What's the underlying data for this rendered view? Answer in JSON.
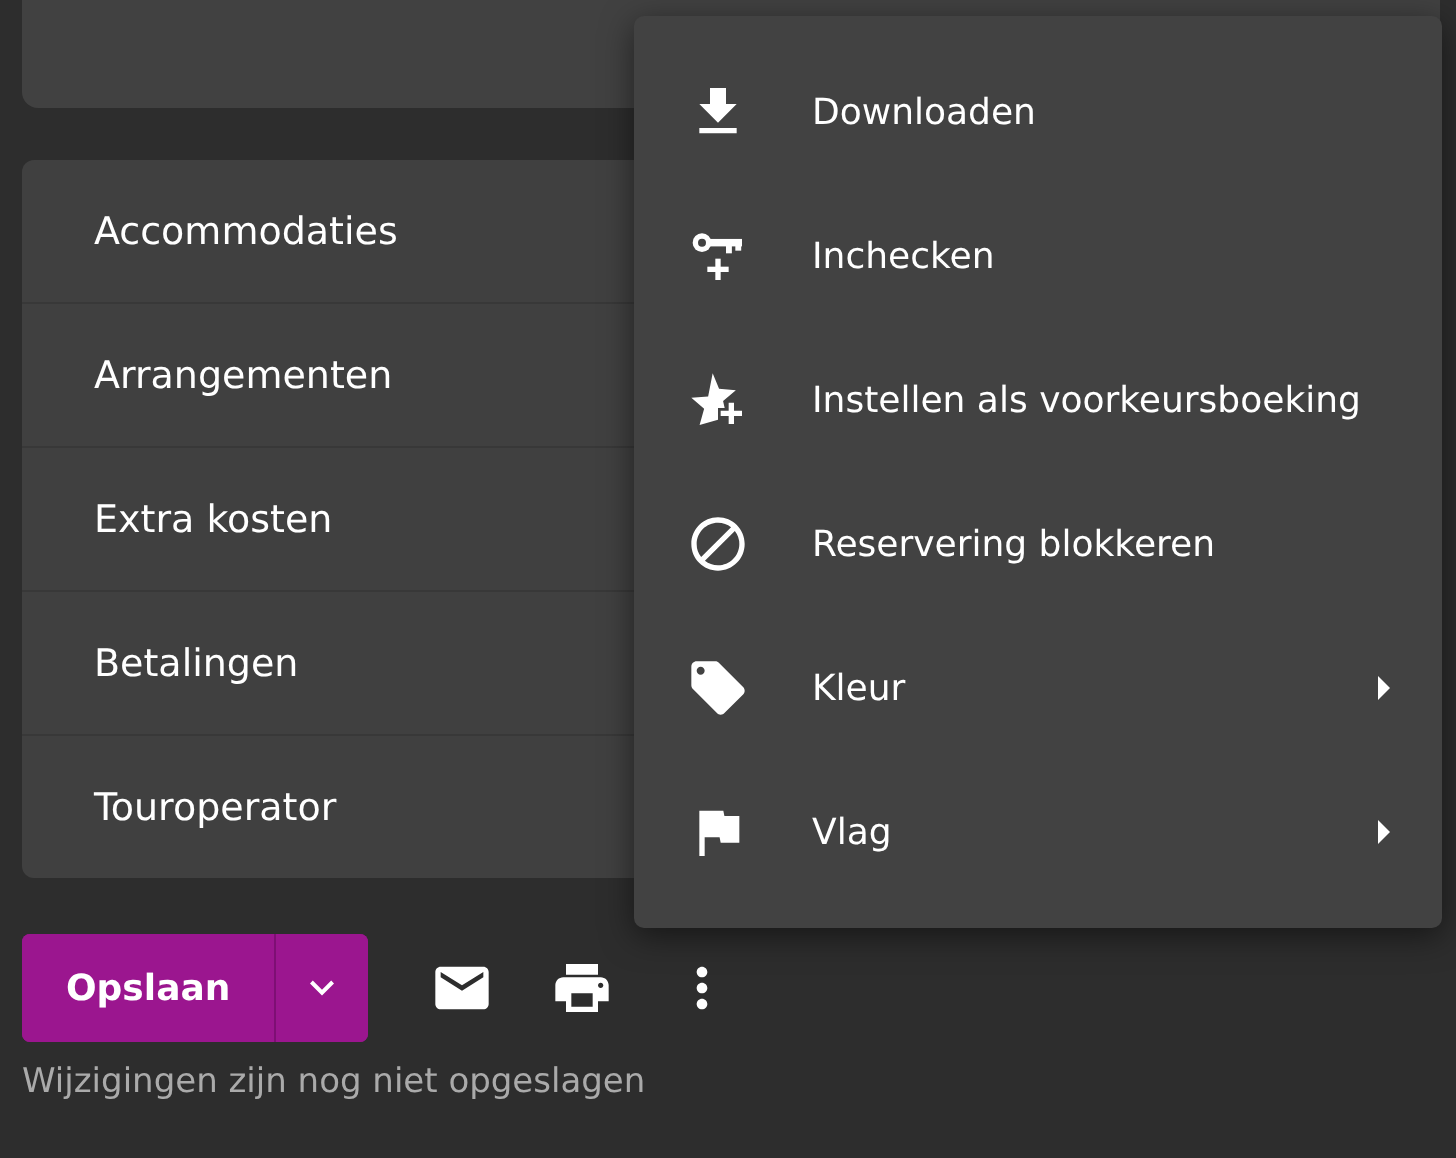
{
  "sections": [
    {
      "label": "Accommodaties"
    },
    {
      "label": "Arrangementen"
    },
    {
      "label": "Extra kosten"
    },
    {
      "label": "Betalingen"
    },
    {
      "label": "Touroperator"
    }
  ],
  "actions": {
    "save": "Opslaan",
    "status": "Wijzigingen zijn nog niet opgeslagen"
  },
  "menu": [
    {
      "kind": "download",
      "label": "Downloaden",
      "submenu": false
    },
    {
      "kind": "checkin",
      "label": "Inchecken",
      "submenu": false
    },
    {
      "kind": "preference",
      "label": "Instellen als voorkeursboeking",
      "submenu": false
    },
    {
      "kind": "block",
      "label": "Reservering blokkeren",
      "submenu": false
    },
    {
      "kind": "color",
      "label": "Kleur",
      "submenu": true
    },
    {
      "kind": "flag",
      "label": "Vlag",
      "submenu": true
    }
  ]
}
